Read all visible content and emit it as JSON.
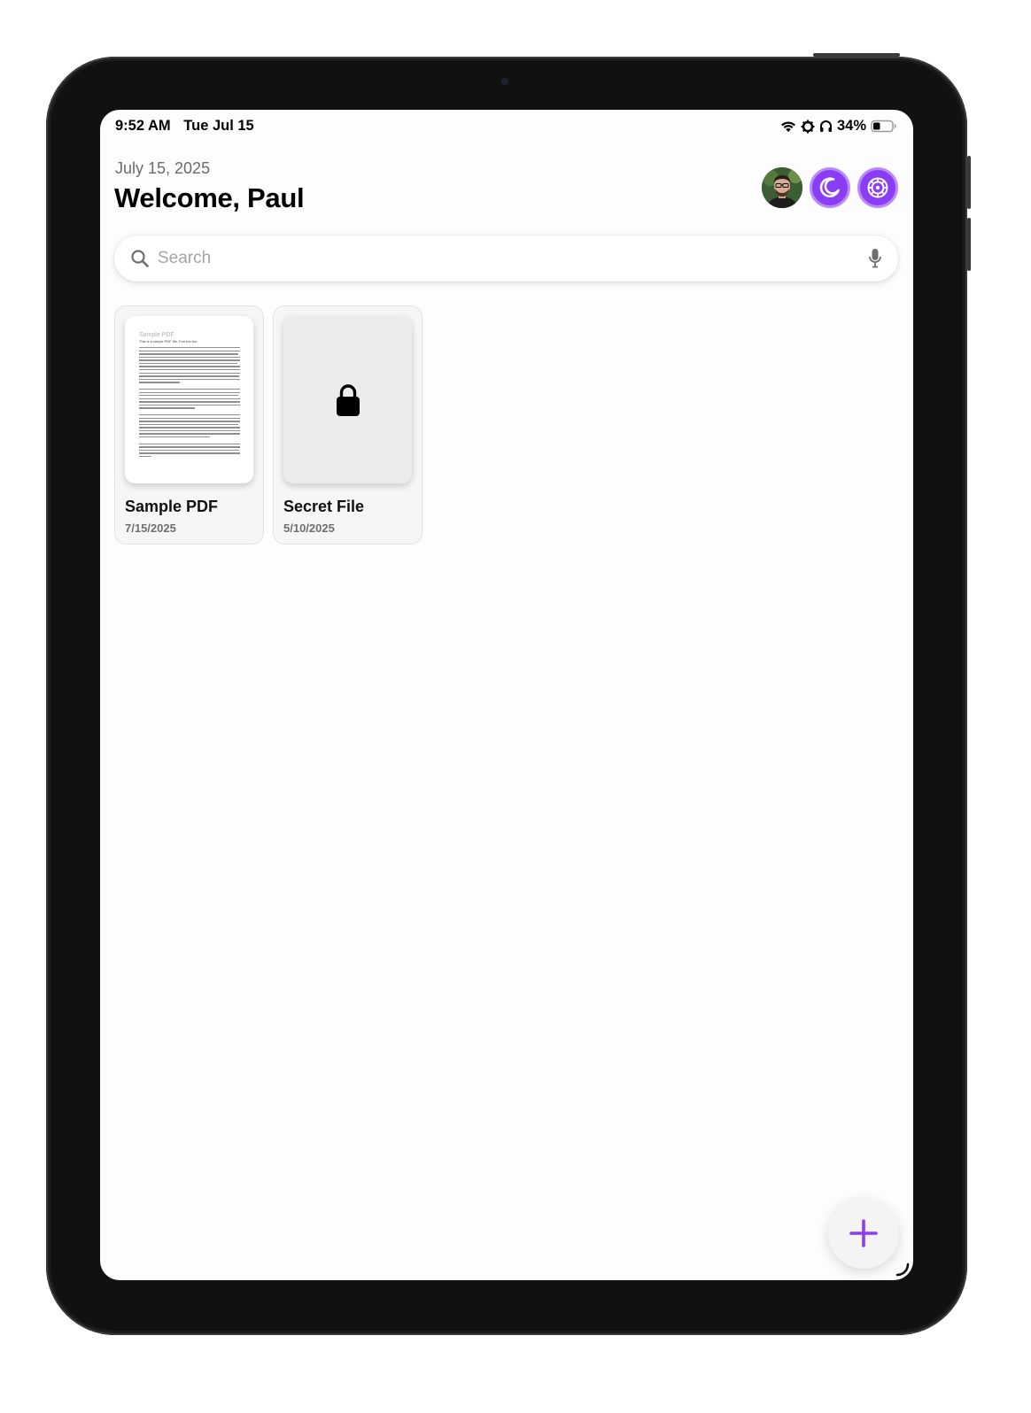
{
  "status_bar": {
    "time": "9:52 AM",
    "date": "Tue Jul 15",
    "battery": "34%",
    "icons": [
      "wifi-icon",
      "focus-icon",
      "headphones-icon",
      "battery-icon"
    ]
  },
  "header": {
    "date": "July 15, 2025",
    "welcome": "Welcome, Paul",
    "actions": [
      "profile-avatar",
      "dark-mode-icon",
      "settings-icon"
    ]
  },
  "search": {
    "placeholder": "Search",
    "icons": [
      "search-icon",
      "microphone-icon"
    ]
  },
  "files": [
    {
      "name": "Sample PDF",
      "date": "7/15/2025",
      "locked": false,
      "preview_title": "Sample PDF",
      "preview_subtitle": "This is a simple PDF file. Fun fun fun."
    },
    {
      "name": "Secret File",
      "date": "5/10/2025",
      "locked": true,
      "icon": "lock-icon"
    }
  ],
  "fab": {
    "icon": "plus-icon"
  },
  "colors": {
    "accent": "#8a3df5",
    "accent_light": "#b98afa",
    "background": "#fdfdfd",
    "card": "#f6f6f6"
  }
}
